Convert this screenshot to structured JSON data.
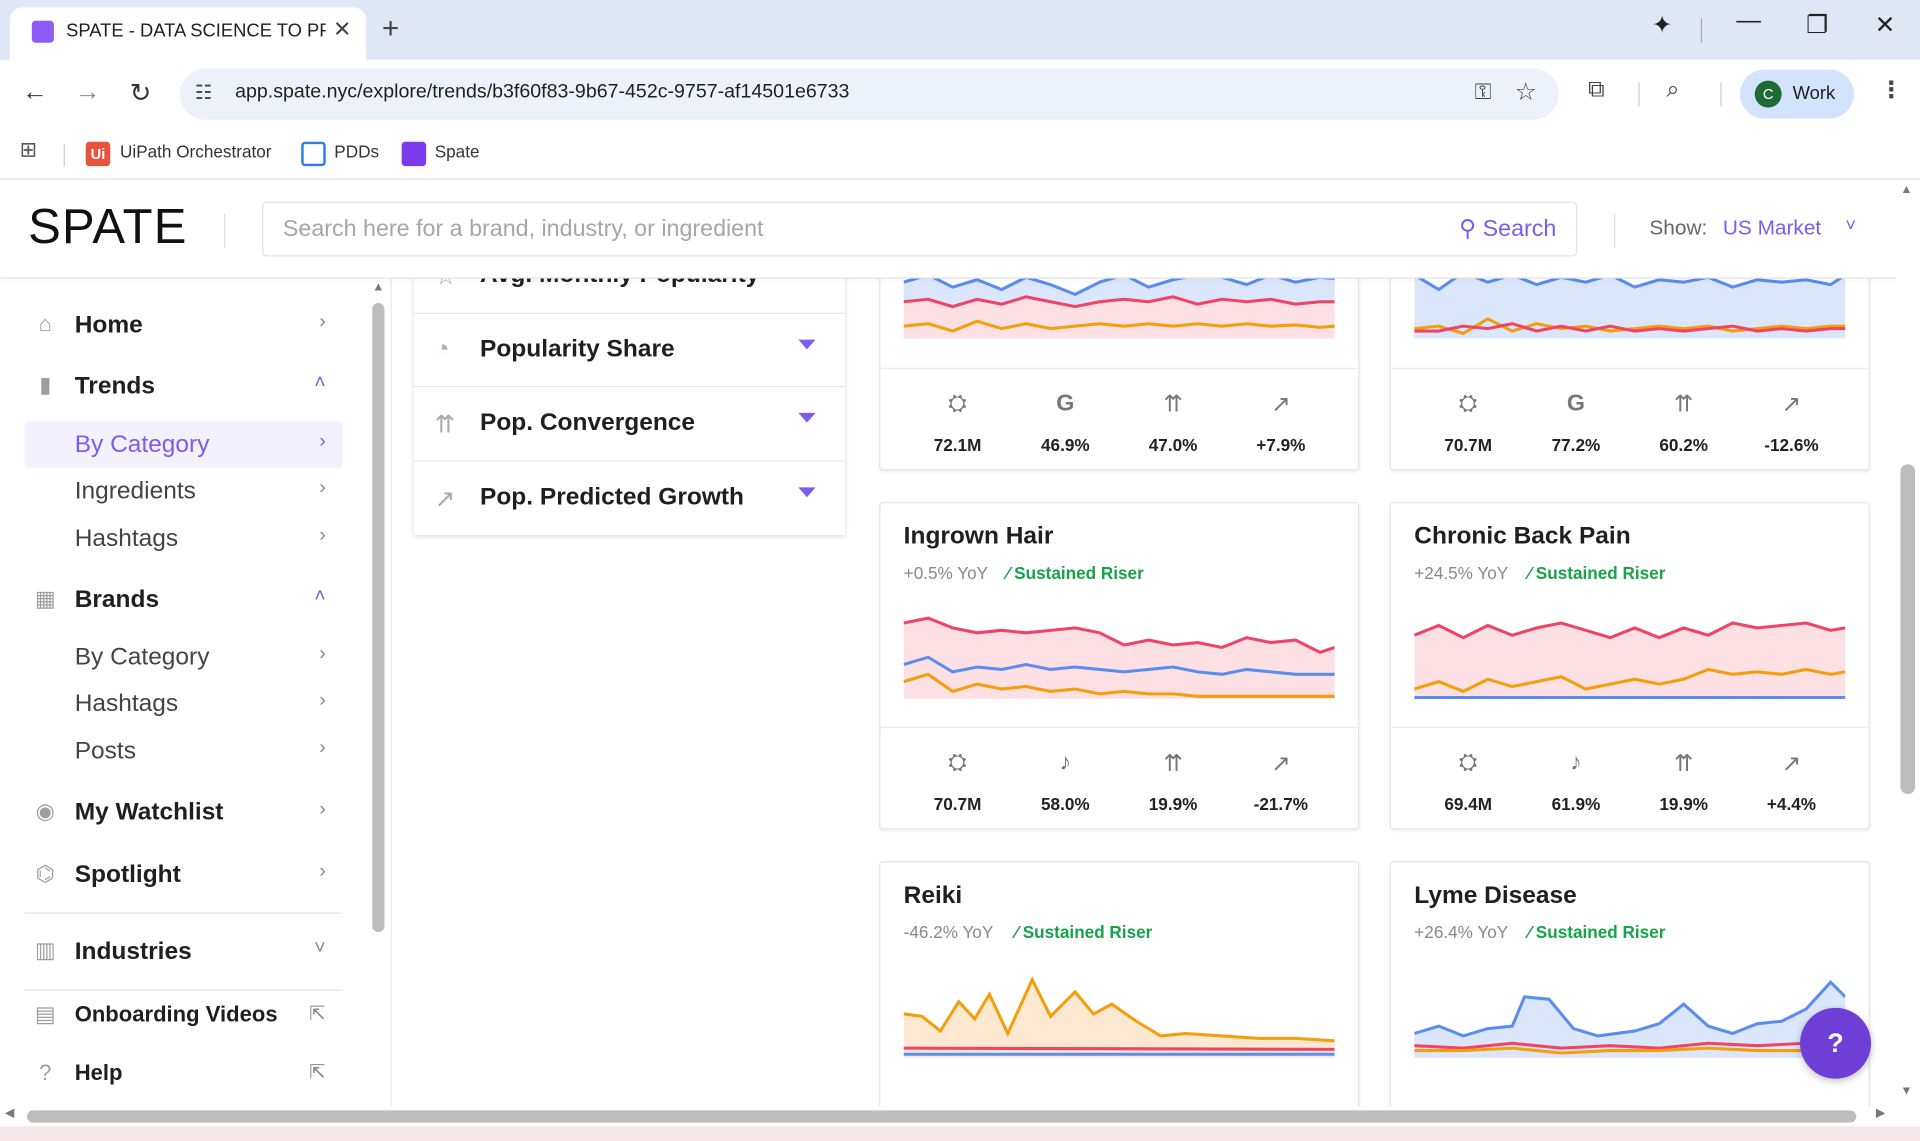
{
  "browser": {
    "tab_title": "SPATE - DATA SCIENCE TO PREDICT",
    "url": "app.spate.nyc/explore/trends/b3f60f83-9b67-452c-9757-af14501e6733",
    "profile_initial": "C",
    "profile_name": "Work",
    "bookmarks": [
      "UiPath Orchestrator",
      "PDDs",
      "Spate"
    ]
  },
  "app": {
    "logo": "SPATE",
    "search_placeholder": "Search here for a brand, industry, or ingredient",
    "search_button": "Search",
    "show_label": "Show:",
    "show_value": "US Market"
  },
  "sidebar": {
    "home": "Home",
    "trends": "Trends",
    "trends_by_category": "By Category",
    "trends_ingredients": "Ingredients",
    "trends_hashtags": "Hashtags",
    "brands": "Brands",
    "brands_by_category": "By Category",
    "brands_hashtags": "Hashtags",
    "brands_posts": "Posts",
    "watchlist": "My Watchlist",
    "spotlight": "Spotlight",
    "industries": "Industries",
    "onboarding": "Onboarding Videos",
    "help": "Help"
  },
  "filters": {
    "partial": "Avg. Monthly Popularity",
    "share": "Popularity Share",
    "convergence": "Pop. Convergence",
    "growth": "Pop. Predicted Growth"
  },
  "cards": {
    "top_left": {
      "stats": [
        "72.1M",
        "46.9%",
        "47.0%",
        "+7.9%"
      ],
      "platform_icon": "google-icon"
    },
    "top_right": {
      "stats": [
        "70.7M",
        "77.2%",
        "60.2%",
        "-12.6%"
      ],
      "platform_icon": "google-icon"
    },
    "ingrown": {
      "name": "Ingrown Hair",
      "yoy": "+0.5% YoY",
      "tag": "Sustained Riser",
      "stats": [
        "70.7M",
        "58.0%",
        "19.9%",
        "-21.7%"
      ],
      "platform_icon": "tiktok-icon"
    },
    "backpain": {
      "name": "Chronic Back Pain",
      "yoy": "+24.5% YoY",
      "tag": "Sustained Riser",
      "stats": [
        "69.4M",
        "61.9%",
        "19.9%",
        "+4.4%"
      ],
      "platform_icon": "tiktok-icon"
    },
    "reiki": {
      "name": "Reiki",
      "yoy": "-46.2% YoY",
      "tag": "Sustained Riser"
    },
    "lyme": {
      "name": "Lyme Disease",
      "yoy": "+26.4% YoY",
      "tag": "Sustained Riser"
    }
  },
  "help_button": "?",
  "colors": {
    "accent": "#7c5cf0",
    "red_series": "#ef4466",
    "blue_series": "#5b8def",
    "orange_series": "#f59e0b",
    "positive": "#16a34a"
  }
}
